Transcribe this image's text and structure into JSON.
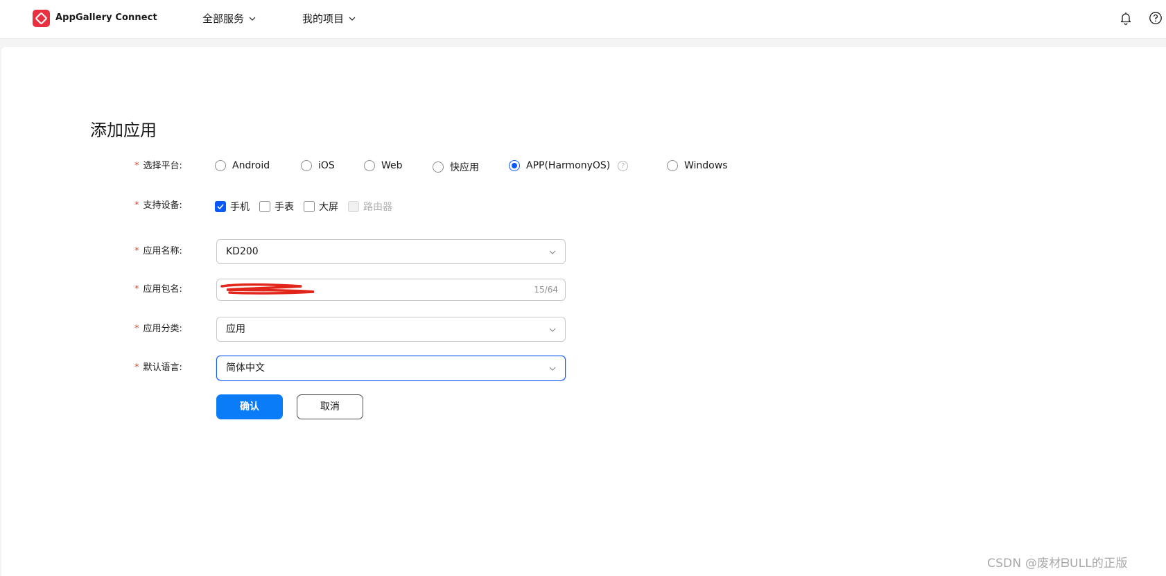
{
  "header": {
    "brand": "AppGallery Connect",
    "nav": [
      {
        "label": "全部服务"
      },
      {
        "label": "我的项目"
      }
    ]
  },
  "page": {
    "title": "添加应用"
  },
  "form": {
    "platform": {
      "label": "选择平台:",
      "options": [
        "Android",
        "iOS",
        "Web",
        "快应用",
        "APP(HarmonyOS)",
        "Windows"
      ],
      "selected": "APP(HarmonyOS)",
      "help": "?"
    },
    "devices": {
      "label": "支持设备:",
      "options": [
        "手机",
        "手表",
        "大屏",
        "路由器"
      ],
      "checked": [
        "手机"
      ],
      "disabled": [
        "路由器"
      ]
    },
    "app_name": {
      "label": "应用名称:",
      "value": "KD200"
    },
    "package_name": {
      "label": "应用包名:",
      "counter": "15/64"
    },
    "category": {
      "label": "应用分类:",
      "value": "应用"
    },
    "language": {
      "label": "默认语言:",
      "value": "简体中文"
    },
    "required_mark": "*",
    "confirm_label": "确认",
    "cancel_label": "取消"
  },
  "watermark": "CSDN @废材ᗷᑌᒪᒪ的正版",
  "colors": {
    "primary": "#0a7cf7",
    "selected": "#0a59f7",
    "required": "#e84026",
    "logo": "#e8303e"
  }
}
